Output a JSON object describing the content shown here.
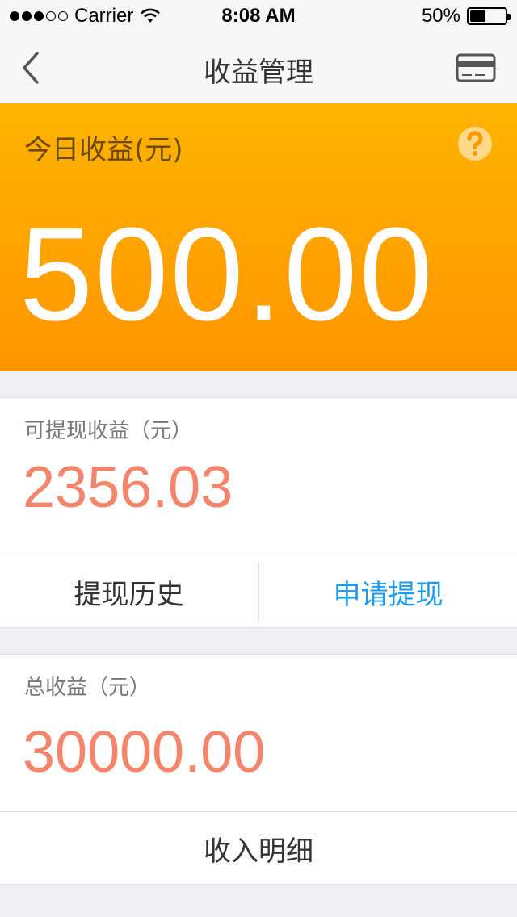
{
  "status_bar": {
    "carrier": "Carrier",
    "time": "8:08 AM",
    "battery": "50%",
    "battery_level": 0.5,
    "signal_bars_filled": 3,
    "signal_bars_total": 5
  },
  "nav": {
    "title": "收益管理",
    "back_icon": "chevron-left-icon",
    "right_icon": "bank-card-icon"
  },
  "today": {
    "label": "今日收益(元)",
    "amount": "500.00",
    "help_icon": "question-mark-icon"
  },
  "withdrawable": {
    "label": "可提现收益（元）",
    "amount": "2356.03"
  },
  "actions": {
    "history_label": "提现历史",
    "apply_label": "申请提现"
  },
  "total": {
    "label": "总收益（元）",
    "amount": "30000.00"
  },
  "details": {
    "label": "收入明细"
  },
  "colors": {
    "header_gradient_top": "#ffb300",
    "header_gradient_bottom": "#ff9500",
    "amount": "#f4856b",
    "link_blue": "#1a9bf0"
  }
}
